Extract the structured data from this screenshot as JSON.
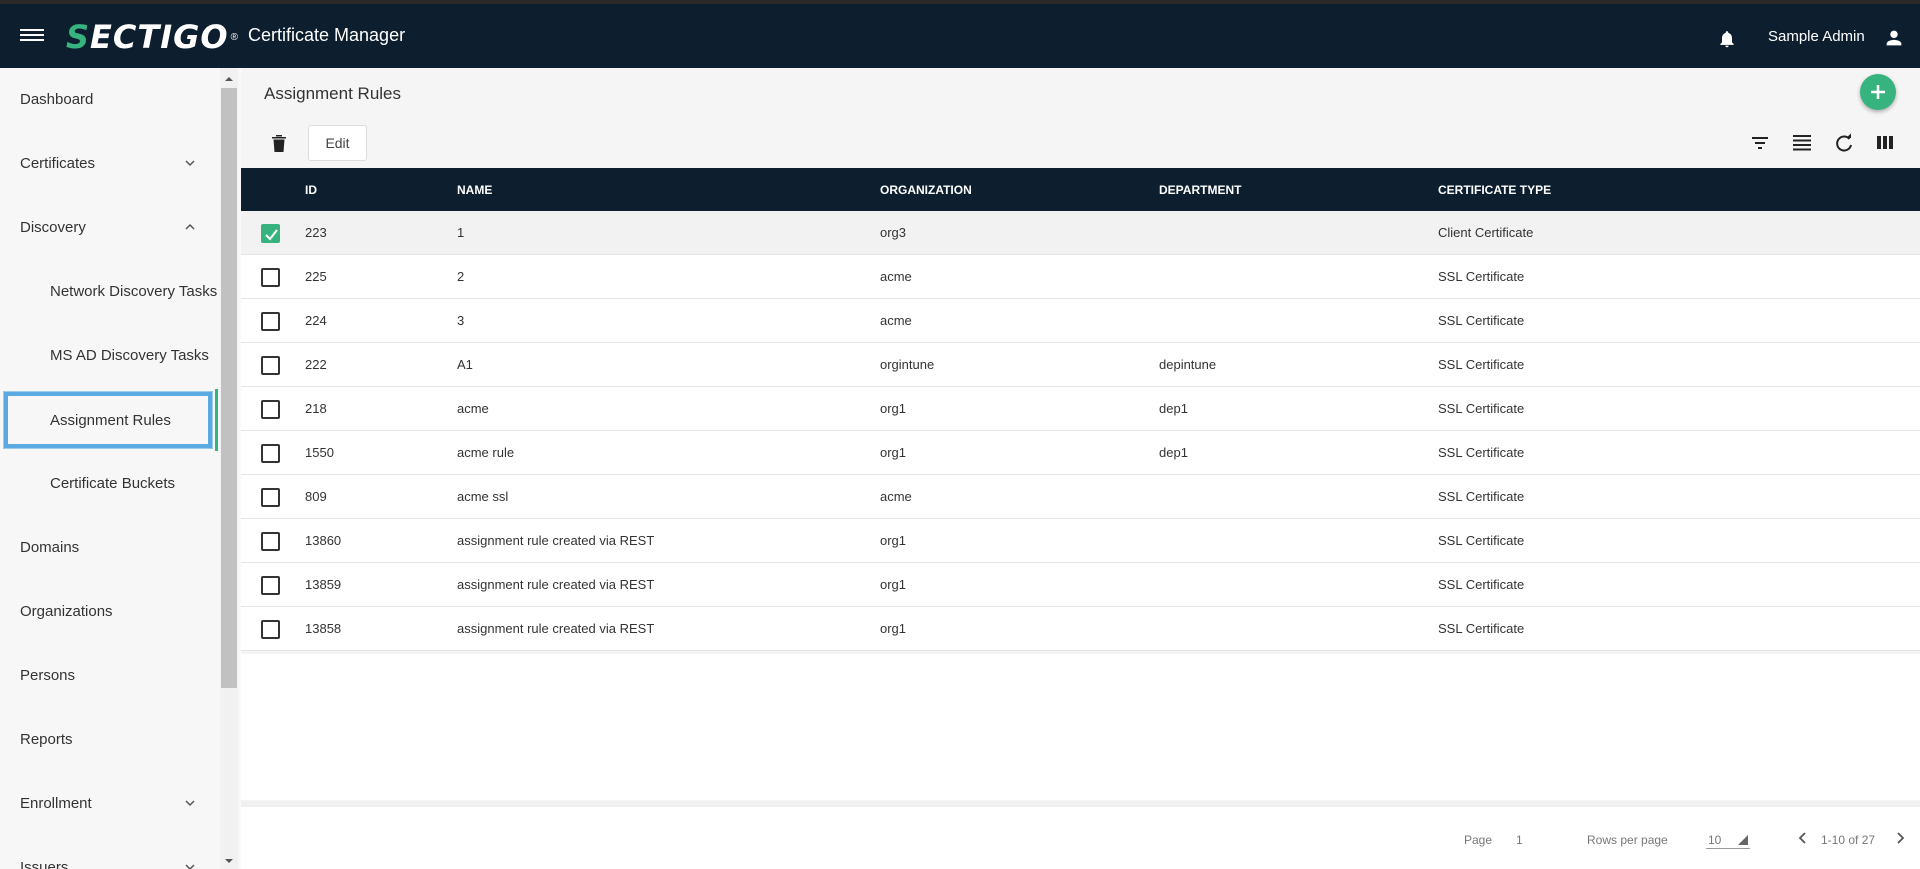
{
  "header": {
    "logo": "SECTIGO",
    "app_title": "Certificate Manager",
    "user_name": "Sample Admin"
  },
  "sidebar": {
    "items": [
      {
        "label": "Dashboard"
      },
      {
        "label": "Certificates",
        "chevron": "down"
      },
      {
        "label": "Discovery",
        "chevron": "up"
      },
      {
        "label": "Network Discovery Tasks"
      },
      {
        "label": "MS AD Discovery Tasks"
      },
      {
        "label": "Assignment Rules",
        "active": true
      },
      {
        "label": "Certificate Buckets"
      },
      {
        "label": "Domains"
      },
      {
        "label": "Organizations"
      },
      {
        "label": "Persons"
      },
      {
        "label": "Reports"
      },
      {
        "label": "Enrollment",
        "chevron": "down"
      },
      {
        "label": "Issuers",
        "chevron": "down"
      }
    ]
  },
  "main": {
    "title": "Assignment Rules",
    "edit_label": "Edit"
  },
  "table": {
    "columns": [
      "ID",
      "NAME",
      "ORGANIZATION",
      "DEPARTMENT",
      "CERTIFICATE TYPE"
    ],
    "rows": [
      {
        "checked": true,
        "id": "223",
        "name": "1",
        "organization": "org3",
        "department": "",
        "certificate_type": "Client Certificate"
      },
      {
        "checked": false,
        "id": "225",
        "name": "2",
        "organization": "acme",
        "department": "",
        "certificate_type": "SSL Certificate"
      },
      {
        "checked": false,
        "id": "224",
        "name": "3",
        "organization": "acme",
        "department": "",
        "certificate_type": "SSL Certificate"
      },
      {
        "checked": false,
        "id": "222",
        "name": "A1",
        "organization": "orgintune",
        "department": "depintune",
        "certificate_type": "SSL Certificate"
      },
      {
        "checked": false,
        "id": "218",
        "name": "acme",
        "organization": "org1",
        "department": "dep1",
        "certificate_type": "SSL Certificate"
      },
      {
        "checked": false,
        "id": "1550",
        "name": "acme rule",
        "organization": "org1",
        "department": "dep1",
        "certificate_type": "SSL Certificate"
      },
      {
        "checked": false,
        "id": "809",
        "name": "acme ssl",
        "organization": "acme",
        "department": "",
        "certificate_type": "SSL Certificate"
      },
      {
        "checked": false,
        "id": "13860",
        "name": "assignment rule created via REST",
        "organization": "org1",
        "department": "",
        "certificate_type": "SSL Certificate"
      },
      {
        "checked": false,
        "id": "13859",
        "name": "assignment rule created via REST",
        "organization": "org1",
        "department": "",
        "certificate_type": "SSL Certificate"
      },
      {
        "checked": false,
        "id": "13858",
        "name": "assignment rule created via REST",
        "organization": "org1",
        "department": "",
        "certificate_type": "SSL Certificate"
      }
    ]
  },
  "footer": {
    "page_label": "Page",
    "page_value": "1",
    "rows_per_page_label": "Rows per page",
    "rows_per_page_value": "10",
    "range_text": "1-10 of 27"
  },
  "colors": {
    "header_bg": "#0d1f2e",
    "accent_green": "#36b37e",
    "active_outline": "#5aa9e0"
  },
  "icons": [
    "hamburger-icon",
    "bell-icon",
    "user-icon",
    "chevron-down-icon",
    "chevron-up-icon",
    "plus-icon",
    "trash-icon",
    "filter-icon",
    "density-icon",
    "refresh-icon",
    "columns-icon",
    "check-icon",
    "chevron-left-icon",
    "chevron-right-icon"
  ]
}
